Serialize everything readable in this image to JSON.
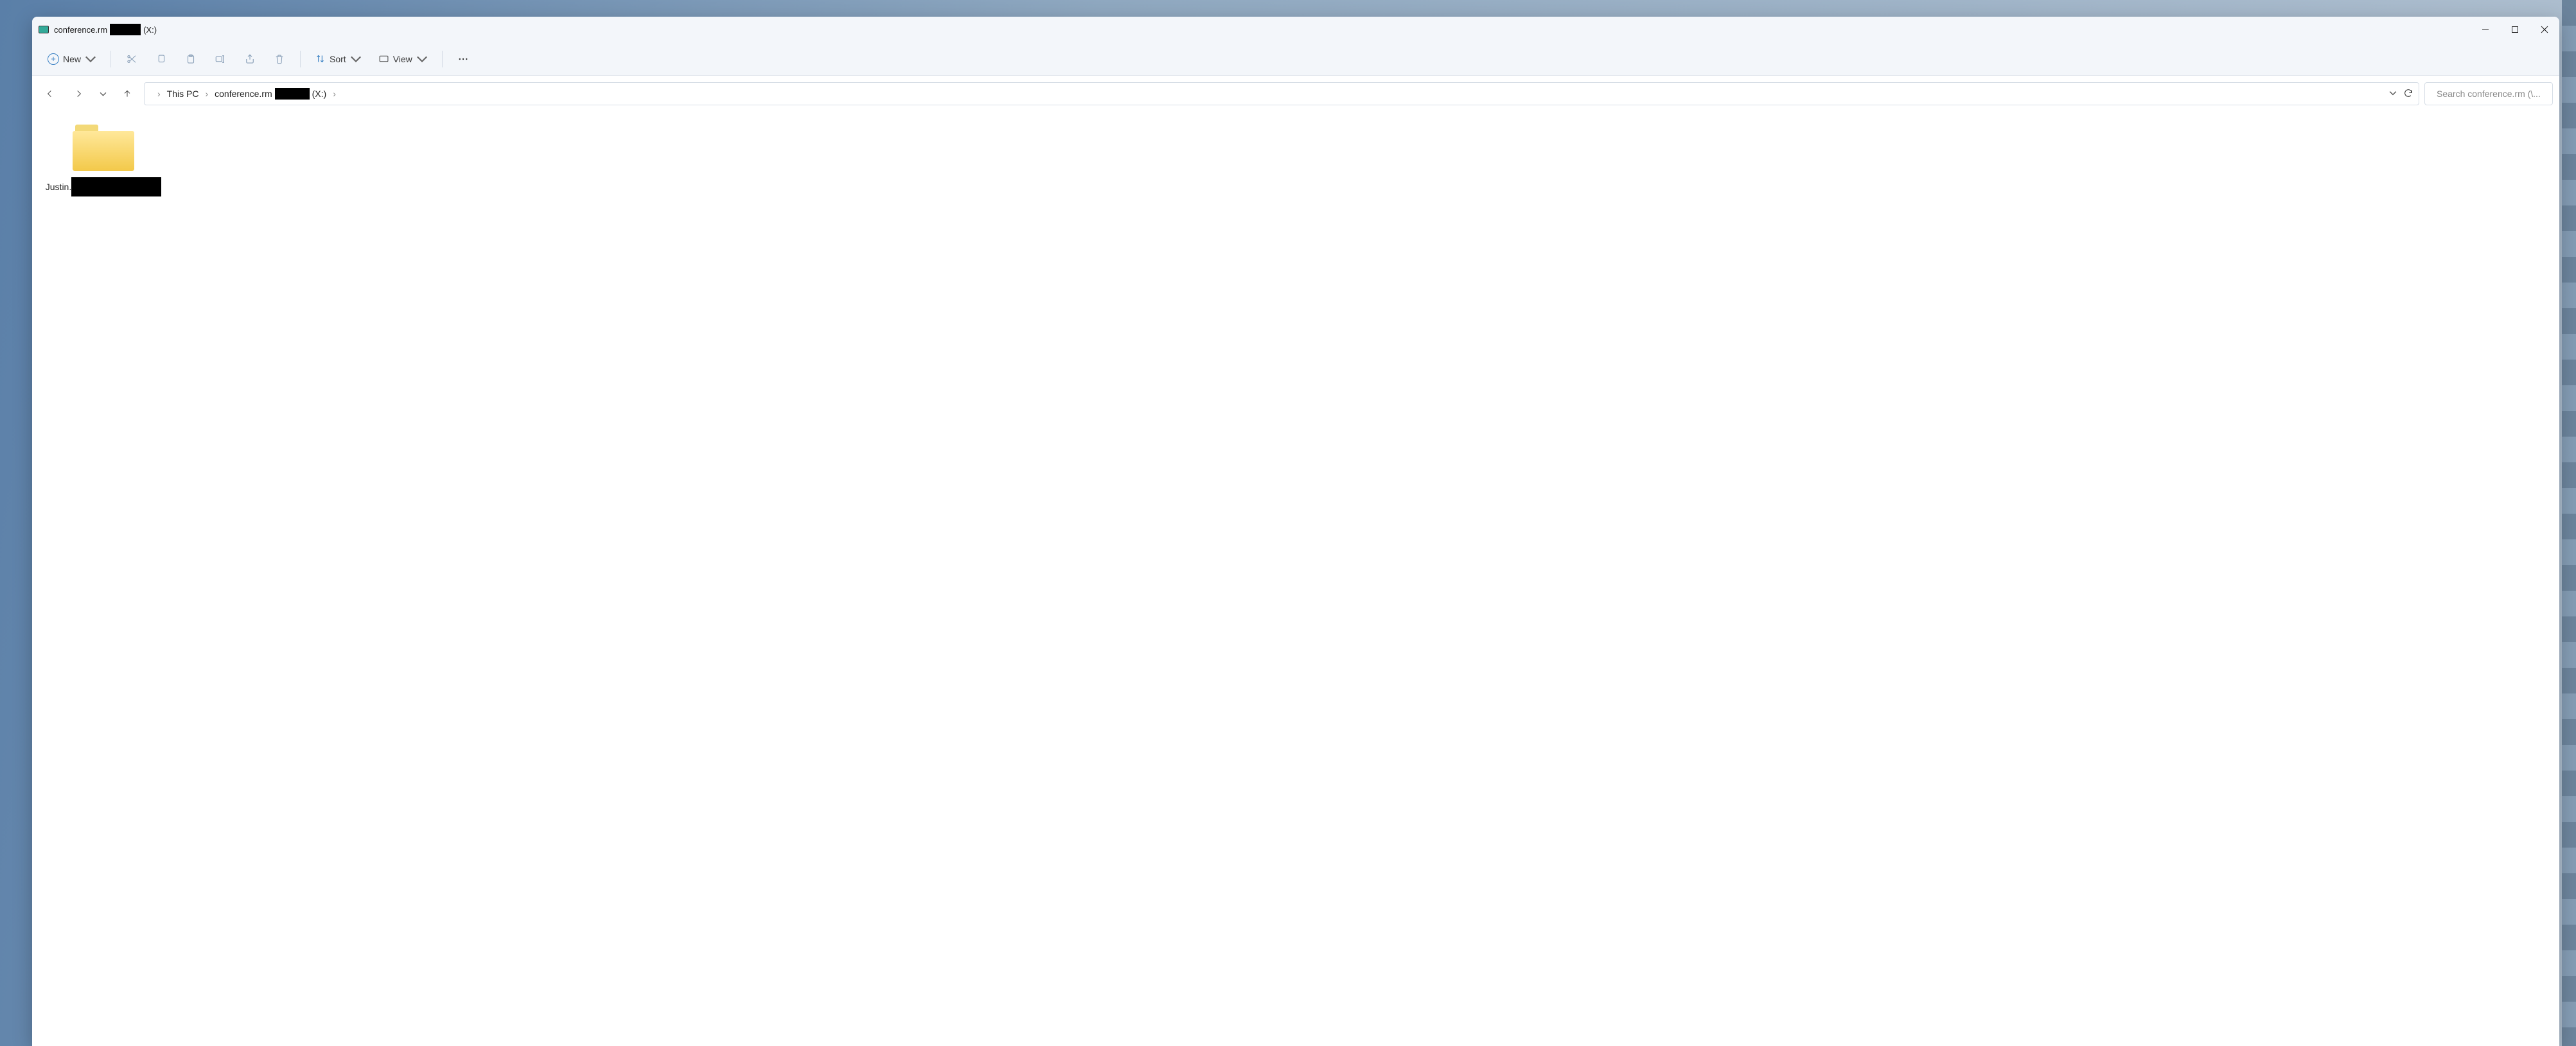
{
  "window": {
    "title_prefix": "conference.rm",
    "title_suffix": "(X:)"
  },
  "toolbar": {
    "new_label": "New",
    "sort_label": "Sort",
    "view_label": "View"
  },
  "breadcrumb": {
    "root": "This PC",
    "loc_prefix": "conference.rm",
    "loc_suffix": "(X:)"
  },
  "search": {
    "placeholder": "Search conference.rm (\\..."
  },
  "items": [
    {
      "name_prefix": "Justin."
    }
  ]
}
